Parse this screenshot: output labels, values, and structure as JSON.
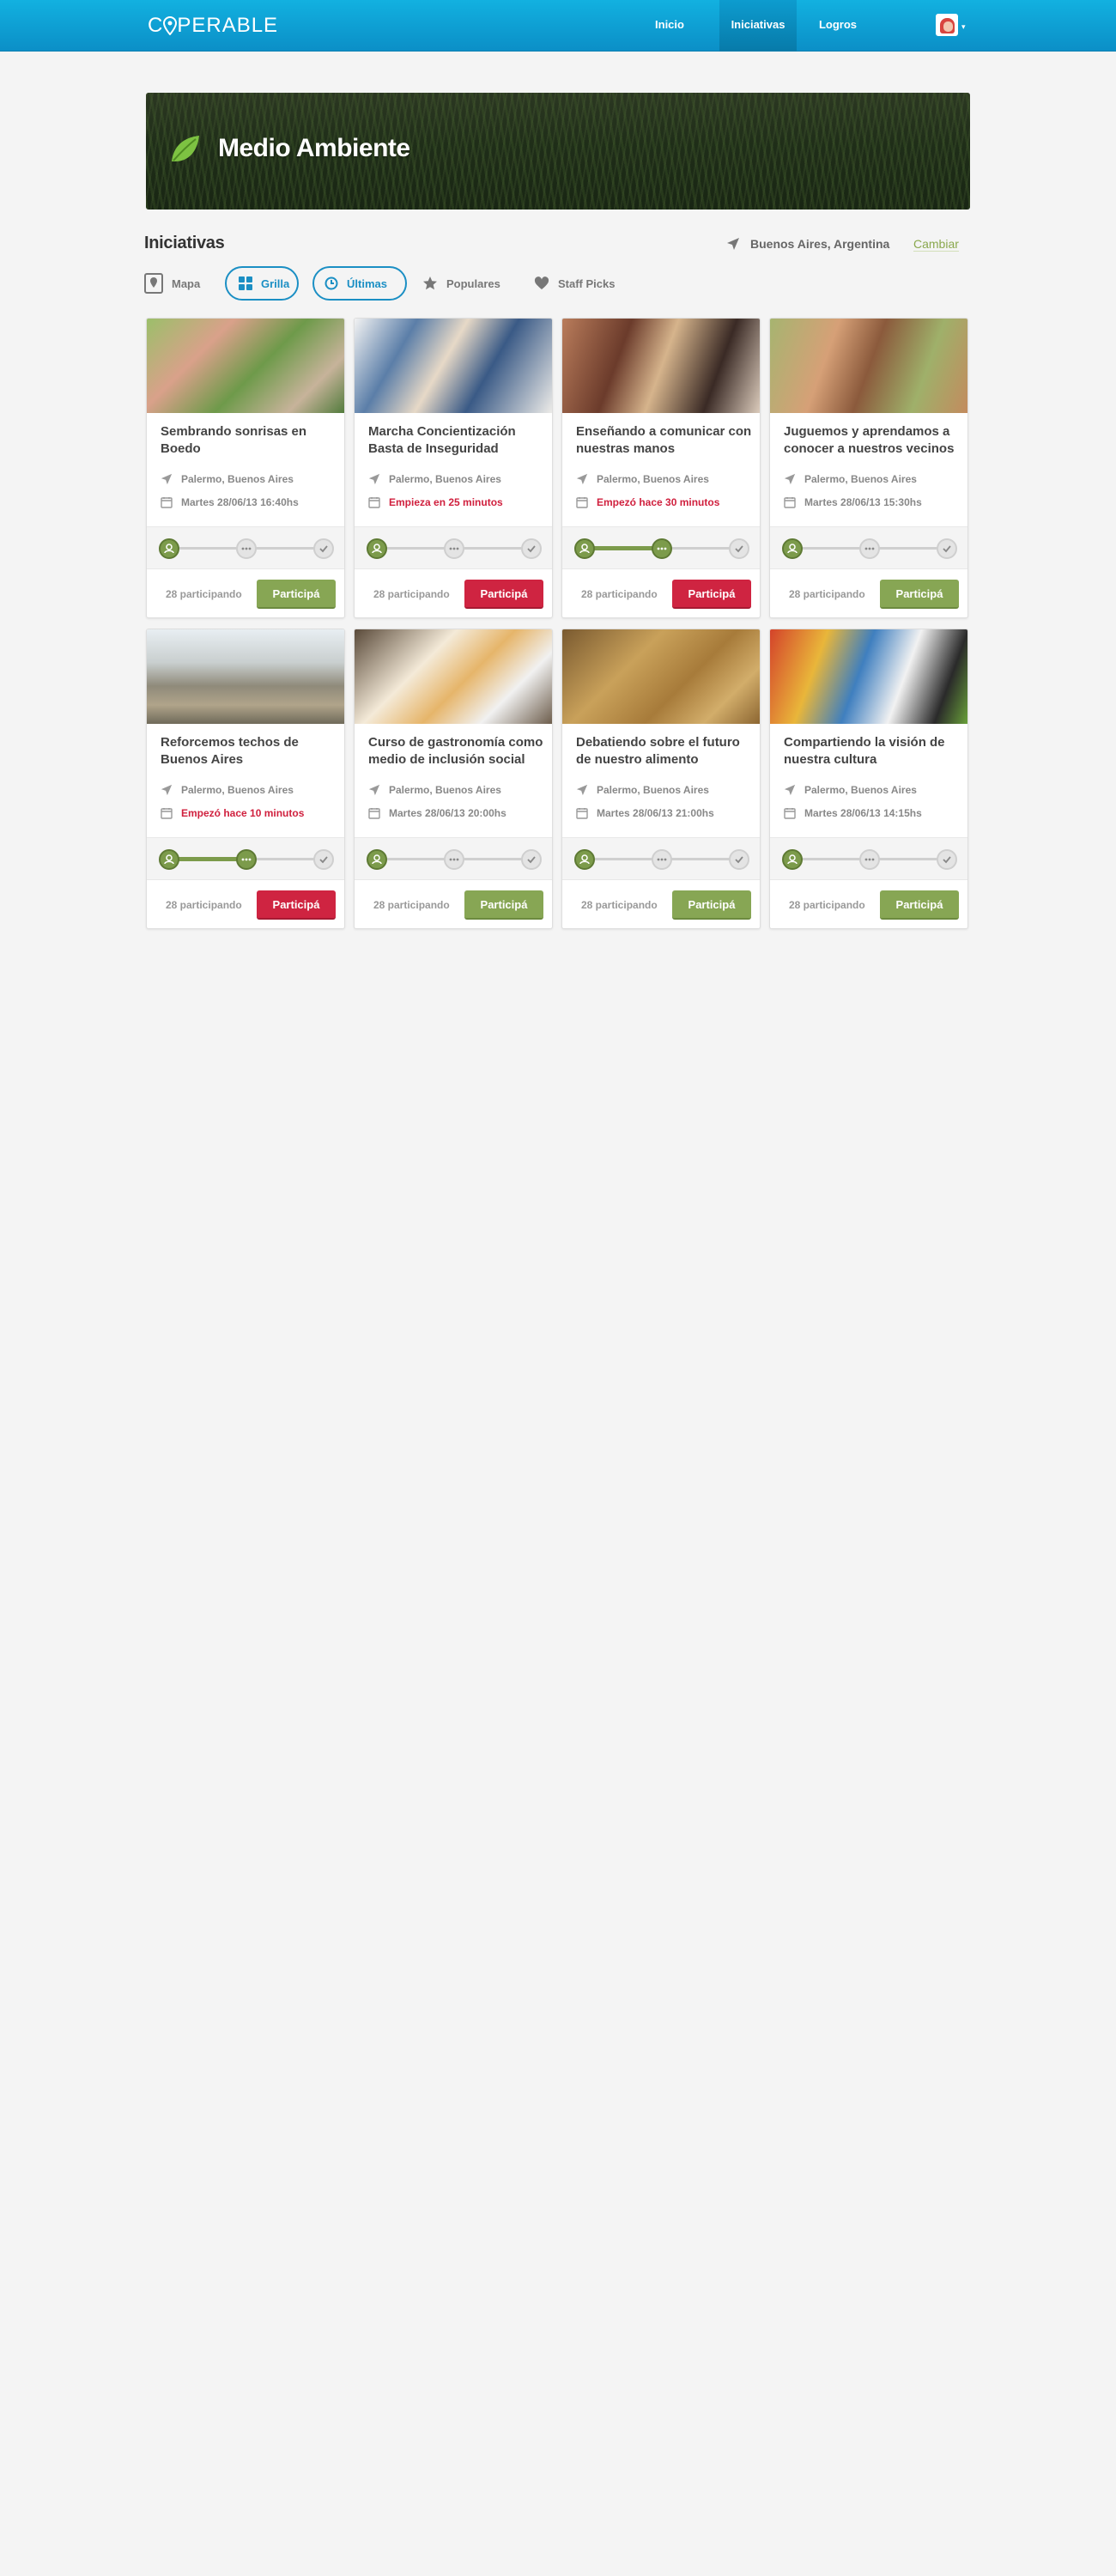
{
  "brand": {
    "logo_text_left": "C",
    "logo_text_right": "PERABLE"
  },
  "nav": {
    "items": [
      {
        "label": "Inicio",
        "active": false
      },
      {
        "label": "Iniciativas",
        "active": true
      },
      {
        "label": "Logros",
        "active": false
      }
    ]
  },
  "banner": {
    "title": "Medio Ambiente",
    "icon": "leaf-icon"
  },
  "section": {
    "title": "Iniciativas",
    "location": "Buenos Aires, Argentina",
    "change_label": "Cambiar"
  },
  "filters": {
    "mapa": "Mapa",
    "grilla": "Grilla",
    "ultimas": "Últimas",
    "populares": "Populares",
    "staff": "Staff Picks"
  },
  "colors": {
    "accent_blue": "#1b8fc4",
    "green": "#87a654",
    "red": "#cf2441"
  },
  "cards": [
    {
      "title": "Sembrando sonrisas en Boedo",
      "location": "Palermo, Buenos Aires",
      "date": "Martes 28/06/13 16:40hs",
      "urgent": false,
      "progress": 0,
      "participants": "28 participando",
      "button": "Participá",
      "button_color": "green"
    },
    {
      "title": "Marcha Concientización Basta de Inseguridad",
      "location": "Palermo, Buenos Aires",
      "date": "Empieza en 25 minutos",
      "urgent": true,
      "progress": 0,
      "participants": "28 participando",
      "button": "Participá",
      "button_color": "red"
    },
    {
      "title": "Enseñando a comunicar con nuestras manos",
      "location": "Palermo, Buenos Aires",
      "date": "Empezó hace 30 minutos",
      "urgent": true,
      "progress": 0.5,
      "participants": "28 participando",
      "button": "Participá",
      "button_color": "red"
    },
    {
      "title": "Juguemos y aprendamos a conocer a nuestros vecinos",
      "location": "Palermo, Buenos Aires",
      "date": "Martes 28/06/13 15:30hs",
      "urgent": false,
      "progress": 0,
      "participants": "28 participando",
      "button": "Participá",
      "button_color": "green"
    },
    {
      "title": "Reforcemos techos de Buenos Aires",
      "location": "Palermo, Buenos Aires",
      "date": "Empezó hace 10 minutos",
      "urgent": true,
      "progress": 0.5,
      "participants": "28 participando",
      "button": "Participá",
      "button_color": "red"
    },
    {
      "title": "Curso de gastronomía como medio de inclusión social",
      "location": "Palermo, Buenos Aires",
      "date": "Martes 28/06/13 20:00hs",
      "urgent": false,
      "progress": 0,
      "participants": "28 participando",
      "button": "Participá",
      "button_color": "green"
    },
    {
      "title": "Debatiendo sobre el futuro de nuestro alimento",
      "location": "Palermo, Buenos Aires",
      "date": "Martes 28/06/13 21:00hs",
      "urgent": false,
      "progress": 0,
      "participants": "28 participando",
      "button": "Participá",
      "button_color": "green"
    },
    {
      "title": "Compartiendo la visión de nuestra cultura",
      "location": "Palermo, Buenos Aires",
      "date": "Martes 28/06/13 14:15hs",
      "urgent": false,
      "progress": 0,
      "participants": "28 participando",
      "button": "Participá",
      "button_color": "green"
    }
  ]
}
